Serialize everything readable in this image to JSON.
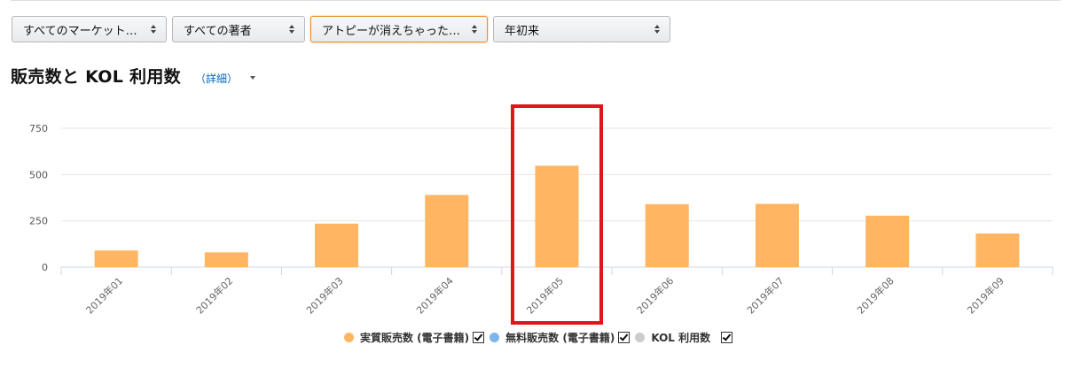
{
  "filters": [
    {
      "value": "すべてのマーケット…",
      "active": false,
      "width": 175
    },
    {
      "value": "すべての著者",
      "active": false,
      "width": 150
    },
    {
      "value": "アトピーが消えちゃった…",
      "active": true,
      "width": 200
    },
    {
      "value": "年初来",
      "active": false,
      "width": 200
    }
  ],
  "header": {
    "title": "販売数と KOL 利用数",
    "detail_link": "（詳細）"
  },
  "chart_data": {
    "type": "bar",
    "categories": [
      "2019年01",
      "2019年02",
      "2019年03",
      "2019年04",
      "2019年05",
      "2019年06",
      "2019年07",
      "2019年08",
      "2019年09"
    ],
    "series": [
      {
        "name": "実質販売数 (電子書籍)",
        "color": "#ffb562",
        "values": [
          90,
          80,
          235,
          390,
          548,
          340,
          342,
          278,
          182
        ]
      },
      {
        "name": "無料販売数 (電子書籍)",
        "color": "#7cb5ec",
        "values": [
          0,
          0,
          0,
          0,
          0,
          0,
          0,
          0,
          0
        ]
      },
      {
        "name": "KOL 利用数",
        "color": "#cccccc",
        "values": [
          0,
          0,
          0,
          0,
          0,
          0,
          0,
          0,
          0
        ]
      }
    ],
    "yticks": [
      0,
      250,
      500,
      750
    ],
    "ylim": [
      0,
      750
    ],
    "grid": true,
    "legend": "bottom-center",
    "highlight_category": "2019年05",
    "highlight_color": "#e0161c"
  },
  "legend": [
    {
      "label": "実質販売数 (電子書籍)",
      "color": "#ffb562",
      "checked": true
    },
    {
      "label": "無料販売数 (電子書籍)",
      "color": "#7cb5ec",
      "checked": true
    },
    {
      "label": "KOL 利用数",
      "color": "#cccccc",
      "checked": true
    }
  ]
}
